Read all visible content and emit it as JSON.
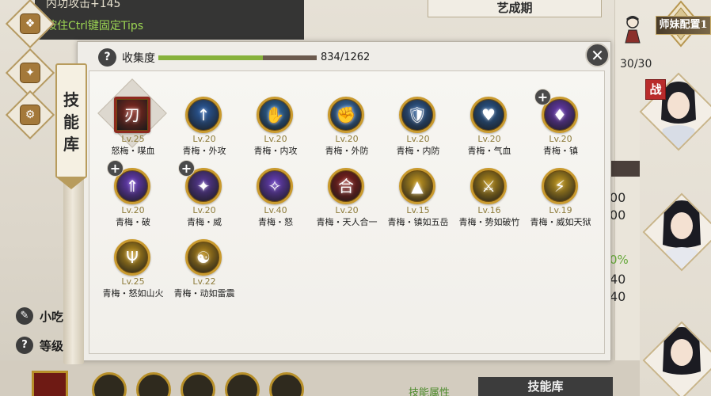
{
  "tooltip": {
    "line1": "内功攻击+145",
    "line2": "按住Ctrl键固定Tips"
  },
  "top_title": "艺成期",
  "count": "30/30",
  "config_label": "师妹配置1",
  "zhan_badge": "战",
  "right_numbers": [
    "00",
    "00",
    "40",
    "40"
  ],
  "right_percent": "0%",
  "bottom": {
    "row1_label": "小吃",
    "row2_label": "等级",
    "attr_label": "技能属性",
    "lib_tab": "技能库"
  },
  "panel": {
    "banner": [
      "技",
      "能",
      "库"
    ],
    "collect_label": "收集度",
    "collect_count": "834/1262",
    "collect_fraction": 0.661,
    "help_glyph": "?",
    "close_glyph": "✕"
  },
  "skills": [
    {
      "level": "Lv.25",
      "name": "怒梅・喋血",
      "color": "#8e2a1f",
      "glyph": "刃",
      "plus": false,
      "selected": true
    },
    {
      "level": "Lv.20",
      "name": "青梅・外攻",
      "color": "#2b5fa8",
      "glyph": "↑",
      "plus": false,
      "selected": false
    },
    {
      "level": "Lv.20",
      "name": "青梅・内攻",
      "color": "#2e6fae",
      "glyph": "✋",
      "plus": false,
      "selected": false
    },
    {
      "level": "Lv.20",
      "name": "青梅・外防",
      "color": "#3b79be",
      "glyph": "✊",
      "plus": false,
      "selected": false
    },
    {
      "level": "Lv.20",
      "name": "青梅・内防",
      "color": "#2d5e9c",
      "glyph": "🛡",
      "plus": false,
      "selected": false
    },
    {
      "level": "Lv.20",
      "name": "青梅・气血",
      "color": "#2a5c97",
      "glyph": "♥",
      "plus": false,
      "selected": false
    },
    {
      "level": "Lv.20",
      "name": "青梅・镇",
      "color": "#6b3bb5",
      "glyph": "♦",
      "plus": true,
      "selected": false
    },
    {
      "level": "Lv.20",
      "name": "青梅・破",
      "color": "#6c3ec4",
      "glyph": "⇑",
      "plus": true,
      "selected": false
    },
    {
      "level": "Lv.20",
      "name": "青梅・威",
      "color": "#5a3a9e",
      "glyph": "✦",
      "plus": true,
      "selected": false
    },
    {
      "level": "Lv.40",
      "name": "青梅・怒",
      "color": "#6a3fc0",
      "glyph": "✧",
      "plus": false,
      "selected": false
    },
    {
      "level": "Lv.20",
      "name": "青梅・天人合一",
      "color": "#8a1f1c",
      "glyph": "合",
      "plus": false,
      "selected": false
    },
    {
      "level": "Lv.15",
      "name": "青梅・镇如五岳",
      "color": "#c79a1f",
      "glyph": "▲",
      "plus": false,
      "selected": false
    },
    {
      "level": "Lv.16",
      "name": "青梅・势如破竹",
      "color": "#b98f1a",
      "glyph": "⚔",
      "plus": false,
      "selected": false
    },
    {
      "level": "Lv.19",
      "name": "青梅・威如天狱",
      "color": "#c49a1e",
      "glyph": "⚡",
      "plus": false,
      "selected": false
    },
    {
      "level": "Lv.25",
      "name": "青梅・怒如山火",
      "color": "#c5971b",
      "glyph": "Ψ",
      "plus": false,
      "selected": false
    },
    {
      "level": "Lv.22",
      "name": "青梅・动如雷震",
      "color": "#b98b19",
      "glyph": "☯",
      "plus": false,
      "selected": false
    }
  ]
}
